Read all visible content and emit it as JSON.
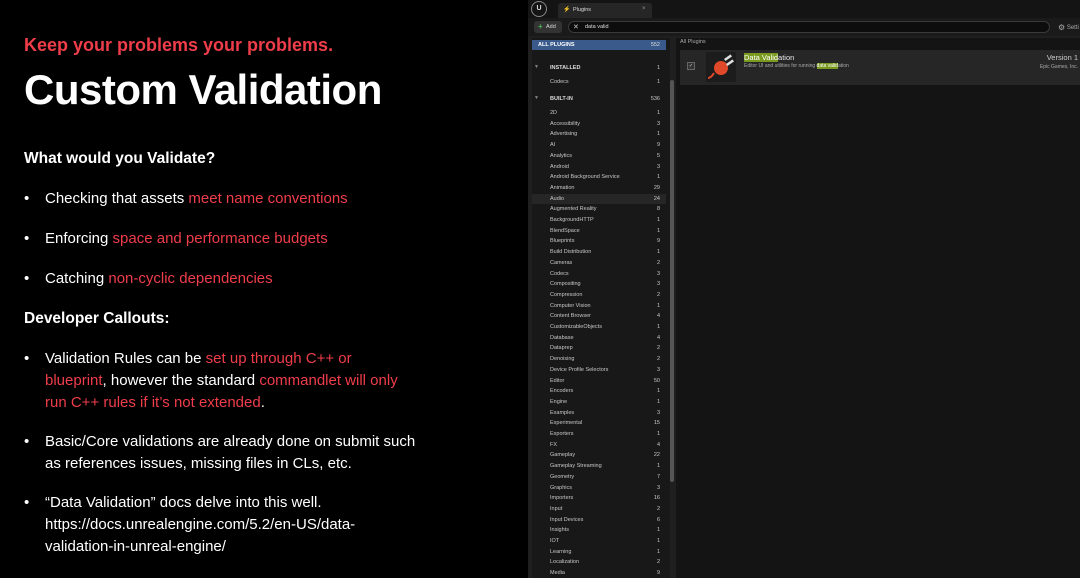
{
  "slide": {
    "kicker": "Keep your problems your problems.",
    "title": "Custom Validation",
    "section1": "What would you Validate?",
    "bullets1": [
      {
        "pre": "Checking that assets ",
        "hl": "meet name conventions"
      },
      {
        "pre": "Enforcing ",
        "hl": "space and performance budgets"
      },
      {
        "pre": "Catching ",
        "hl": "non-cyclic dependencies"
      }
    ],
    "section2": "Developer Callouts:",
    "b4": {
      "t1": "Validation Rules can be ",
      "h1": "set up through C++ or blueprint",
      "t2": ", however the standard ",
      "h2": "commandlet will only run C++ rules if it’s not extended",
      "t3": "."
    },
    "b5": "Basic/Core validations are already done on submit such as references issues, missing files in CLs, etc.",
    "b6": "“Data Validation” docs delve into this well. https://docs.unrealengine.com/5.2/en-US/data-validation-in-unreal-engine/",
    "bullet_glyph": "•",
    "accent": "#ef3d4a"
  },
  "editor": {
    "logo": "U",
    "tab": {
      "icon": "plug-icon",
      "label": "Plugins",
      "close": "×"
    },
    "add_label": "Add",
    "search_value": "data valid",
    "search_clear": "✕",
    "settings_label": "Setti",
    "all_plugins": {
      "label": "ALL PLUGINS",
      "count": "552"
    },
    "installed": {
      "label": "INSTALLED",
      "count": "1"
    },
    "installed_items": [
      {
        "name": "Codecs",
        "count": "1"
      }
    ],
    "builtin": {
      "label": "BUILT-IN",
      "count": "536"
    },
    "categories": [
      {
        "name": "2D",
        "count": "1"
      },
      {
        "name": "Accessibility",
        "count": "3"
      },
      {
        "name": "Advertising",
        "count": "1"
      },
      {
        "name": "AI",
        "count": "9"
      },
      {
        "name": "Analytics",
        "count": "5"
      },
      {
        "name": "Android",
        "count": "3"
      },
      {
        "name": "Android Background Service",
        "count": "1"
      },
      {
        "name": "Animation",
        "count": "29"
      },
      {
        "name": "Audio",
        "count": "24"
      },
      {
        "name": "Augmented Reality",
        "count": "8"
      },
      {
        "name": "BackgroundHTTP",
        "count": "1"
      },
      {
        "name": "BlendSpace",
        "count": "1"
      },
      {
        "name": "Blueprints",
        "count": "9"
      },
      {
        "name": "Build Distribution",
        "count": "1"
      },
      {
        "name": "Cameras",
        "count": "2"
      },
      {
        "name": "Codecs",
        "count": "3"
      },
      {
        "name": "Compositing",
        "count": "3"
      },
      {
        "name": "Compression",
        "count": "2"
      },
      {
        "name": "Computer Vision",
        "count": "1"
      },
      {
        "name": "Content Browser",
        "count": "4"
      },
      {
        "name": "CustomizableObjects",
        "count": "1"
      },
      {
        "name": "Database",
        "count": "4"
      },
      {
        "name": "Dataprep",
        "count": "2"
      },
      {
        "name": "Denoising",
        "count": "2"
      },
      {
        "name": "Device Profile Selectors",
        "count": "3"
      },
      {
        "name": "Editor",
        "count": "50"
      },
      {
        "name": "Encoders",
        "count": "1"
      },
      {
        "name": "Engine",
        "count": "1"
      },
      {
        "name": "Examples",
        "count": "3"
      },
      {
        "name": "Experimental",
        "count": "15"
      },
      {
        "name": "Exporters",
        "count": "1"
      },
      {
        "name": "FX",
        "count": "4"
      },
      {
        "name": "Gameplay",
        "count": "22"
      },
      {
        "name": "Gameplay Streaming",
        "count": "1"
      },
      {
        "name": "Geometry",
        "count": "7"
      },
      {
        "name": "Graphics",
        "count": "3"
      },
      {
        "name": "Importers",
        "count": "16"
      },
      {
        "name": "Input",
        "count": "2"
      },
      {
        "name": "Input Devices",
        "count": "6"
      },
      {
        "name": "Insights",
        "count": "1"
      },
      {
        "name": "IOT",
        "count": "1"
      },
      {
        "name": "Learning",
        "count": "1"
      },
      {
        "name": "Localization",
        "count": "2"
      },
      {
        "name": "Media",
        "count": "9"
      }
    ],
    "right_header": "All Plugins",
    "plugin": {
      "name_hl": "Data Valid",
      "name_rest": "ation",
      "desc_pre": "Editor UI and utilities for running ",
      "desc_hl": "data valid",
      "desc_post": "ation",
      "version": "Version 1",
      "author": "Epic Games, Inc.",
      "check": "✓",
      "icon": "plug-icon"
    },
    "selection_color": "#3a5a8c",
    "highlight_color": "#7a9a1f"
  }
}
